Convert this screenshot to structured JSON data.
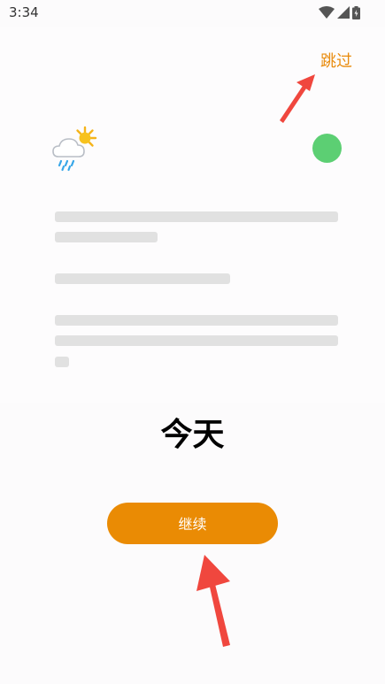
{
  "status_bar": {
    "time": "3:34",
    "icons": [
      "wifi-icon",
      "cell-signal-icon",
      "battery-icon"
    ]
  },
  "header": {
    "skip_label": "跳过"
  },
  "card": {
    "weather_icon": "rain-sun-icon",
    "status_dot_color": "#5ccf73"
  },
  "main": {
    "title": "今天",
    "continue_label": "继续"
  },
  "colors": {
    "accent": "#ea8b04",
    "annotation_arrow": "#f0473e"
  }
}
